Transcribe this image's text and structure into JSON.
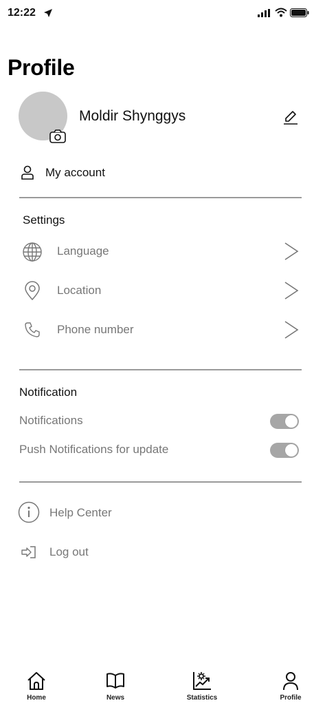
{
  "status_bar": {
    "time": "12:22"
  },
  "header": {
    "title": "Profile"
  },
  "profile": {
    "name": "Moldir Shynggys"
  },
  "account": {
    "label": "My account"
  },
  "settings": {
    "title": "Settings",
    "items": [
      {
        "label": "Language",
        "icon": "globe-icon"
      },
      {
        "label": "Location",
        "icon": "map-pin-icon"
      },
      {
        "label": "Phone number",
        "icon": "phone-icon"
      }
    ]
  },
  "notification": {
    "title": "Notification",
    "items": [
      {
        "label": "Notifications",
        "enabled": true
      },
      {
        "label": "Push Notifications for update",
        "enabled": true
      }
    ]
  },
  "help": {
    "label": "Help Center"
  },
  "logout": {
    "label": "Log out"
  },
  "tabbar": {
    "items": [
      {
        "label": "Home",
        "icon": "home-icon"
      },
      {
        "label": "News",
        "icon": "book-icon"
      },
      {
        "label": "Statistics",
        "icon": "statistics-icon"
      },
      {
        "label": "Profile",
        "icon": "person-icon"
      }
    ]
  },
  "colors": {
    "accent": "#111111",
    "muted": "#777777",
    "toggle": "#a6a6a6",
    "avatar": "#c8c8c8"
  }
}
